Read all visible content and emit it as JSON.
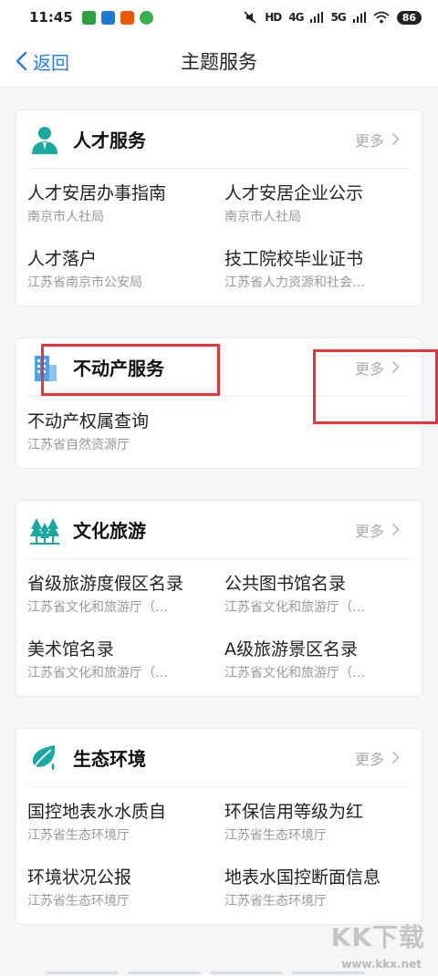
{
  "status": {
    "time": "11:45",
    "sig1": "HD",
    "sig2": "4G",
    "sig3": "5G",
    "battery": "86"
  },
  "nav": {
    "back_label": "返回",
    "title": "主题服务"
  },
  "more_label": "更多",
  "cards": [
    {
      "title": "人才服务",
      "items": [
        {
          "name": "人才安居办事指南",
          "dept": "南京市人社局"
        },
        {
          "name": "人才安居企业公示",
          "dept": "南京市人社局"
        },
        {
          "name": "人才落户",
          "dept": "江苏省南京市公安局"
        },
        {
          "name": "技工院校毕业证书",
          "dept": "江苏省人力资源和社会…"
        }
      ]
    },
    {
      "title": "不动产服务",
      "items": [
        {
          "name": "不动产权属查询",
          "dept": "江苏省自然资源厅"
        }
      ]
    },
    {
      "title": "文化旅游",
      "items": [
        {
          "name": "省级旅游度假区名录",
          "dept": "江苏省文化和旅游厅（…"
        },
        {
          "name": "公共图书馆名录",
          "dept": "江苏省文化和旅游厅（…"
        },
        {
          "name": "美术馆名录",
          "dept": "江苏省文化和旅游厅（…"
        },
        {
          "name": "A级旅游景区名录",
          "dept": "江苏省文化和旅游厅（…"
        }
      ]
    },
    {
      "title": "生态环境",
      "items": [
        {
          "name": "国控地表水水质自",
          "dept": "江苏省生态环境厅"
        },
        {
          "name": "环保信用等级为红",
          "dept": "江苏省生态环境厅"
        },
        {
          "name": "环境状况公报",
          "dept": "江苏省生态环境厅"
        },
        {
          "name": "地表水国控断面信息",
          "dept": "江苏省生态环境厅"
        }
      ]
    }
  ],
  "watermark": {
    "brand": "KK下载",
    "url": "www.kkx.net"
  },
  "colors": {
    "accent": "#2a7ce0",
    "icon_teal": "#1aa9a1",
    "highlight": "#e8333b"
  }
}
